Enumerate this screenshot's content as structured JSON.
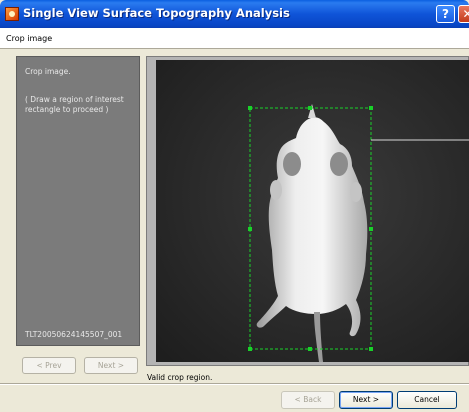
{
  "window": {
    "title": "Single View Surface Topography Analysis",
    "help_glyph": "?",
    "close_glyph": "✕"
  },
  "header": {
    "step_title": "Crop image"
  },
  "left_panel": {
    "line1": "Crop image.",
    "line2": "( Draw a region of interest",
    "line3": "rectangle to proceed )",
    "sequence_id": "TLT20050624145507_001"
  },
  "nav": {
    "prev_label": "< Prev",
    "next_label": "Next >"
  },
  "status": {
    "message": "Valid crop region."
  },
  "footer": {
    "back_label": "< Back",
    "next_label": "Next >",
    "cancel_label": "Cancel"
  },
  "colors": {
    "roi": "#19d12a",
    "titlebar": "#0a54d6",
    "image_bg": "#2e2e2e"
  },
  "icons": {
    "app": "app-logo-icon",
    "help": "help-icon",
    "close": "close-icon"
  }
}
